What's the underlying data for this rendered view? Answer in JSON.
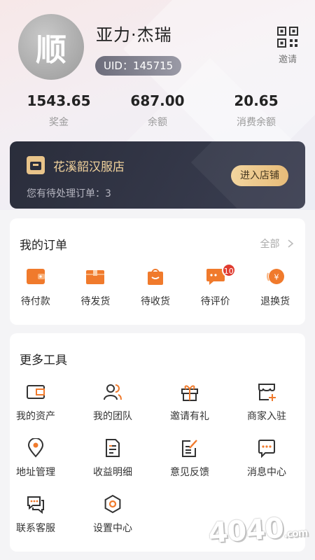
{
  "profile": {
    "avatar_text": "顺",
    "username": "亚力·杰瑞",
    "uid_label": "UID：145715",
    "invite_label": "邀请"
  },
  "stats": [
    {
      "value": "1543.65",
      "label": "奖金"
    },
    {
      "value": "687.00",
      "label": "余额"
    },
    {
      "value": "20.65",
      "label": "消费余额"
    }
  ],
  "store": {
    "name": "花溪韶汉服店",
    "pending": "您有待处理订单：3",
    "enter_label": "进入店铺"
  },
  "orders": {
    "title": "我的订单",
    "all_label": "全部",
    "items": [
      {
        "label": "待付款",
        "icon": "wallet-icon"
      },
      {
        "label": "待发货",
        "icon": "package-icon"
      },
      {
        "label": "待收货",
        "icon": "shopping-bag-icon"
      },
      {
        "label": "待评价",
        "icon": "comment-icon",
        "badge": "10"
      },
      {
        "label": "退换货",
        "icon": "refund-icon"
      }
    ]
  },
  "tools": {
    "title": "更多工具",
    "items": [
      {
        "label": "我的资产",
        "icon": "card-icon"
      },
      {
        "label": "我的团队",
        "icon": "team-icon"
      },
      {
        "label": "邀请有礼",
        "icon": "gift-icon"
      },
      {
        "label": "商家入驻",
        "icon": "store-join-icon"
      },
      {
        "label": "地址管理",
        "icon": "location-icon"
      },
      {
        "label": "收益明细",
        "icon": "document-icon"
      },
      {
        "label": "意见反馈",
        "icon": "feedback-icon"
      },
      {
        "label": "消息中心",
        "icon": "message-icon"
      },
      {
        "label": "联系客服",
        "icon": "customer-service-icon"
      },
      {
        "label": "设置中心",
        "icon": "settings-icon"
      }
    ]
  },
  "watermark": {
    "text": "4040",
    "suffix": ".com"
  },
  "colors": {
    "accent": "#f07a2c",
    "gold": "#e9c48a",
    "dark": "#2a2d3b"
  }
}
